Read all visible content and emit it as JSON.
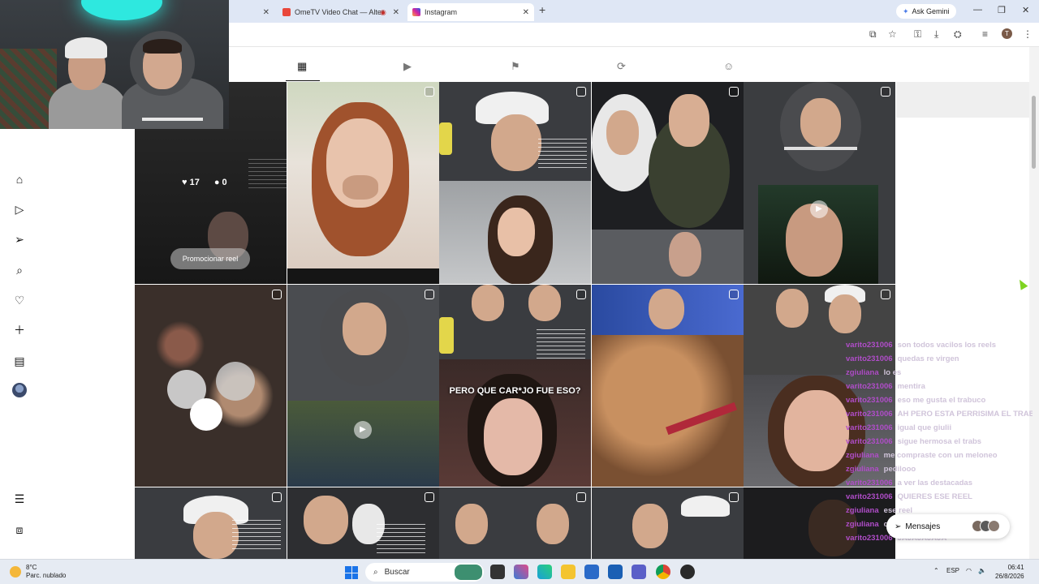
{
  "browser": {
    "tabs": [
      {
        "title": "OmeTV Video Chat — Alter",
        "active": false
      },
      {
        "title": "Instagram",
        "active": true
      }
    ],
    "new_tab": "+",
    "ask_gemini": "Ask Gemini",
    "profile_initial": "T"
  },
  "instagram": {
    "profile_tabs": [
      "posts",
      "reels",
      "saved",
      "reposts",
      "tagged"
    ],
    "first_post": {
      "likes": "17",
      "comments": "0",
      "promote_label": "Promocionar reel"
    },
    "caption_overlay": "PERO QUE CAR*JO FUE ESO?"
  },
  "stream_chat": [
    {
      "user": "varito231006",
      "message": "son todos vacilos los reels"
    },
    {
      "user": "varito231006",
      "message": "quedas re virgen"
    },
    {
      "user": "zgiuliana",
      "message": "lo es"
    },
    {
      "user": "varito231006",
      "message": "mentira"
    },
    {
      "user": "varito231006",
      "message": "eso me gusta el trabuco"
    },
    {
      "user": "varito231006",
      "message": "AH PERO ESTA PERRISIMA EL TRABA"
    },
    {
      "user": "varito231006",
      "message": "igual que giulii"
    },
    {
      "user": "varito231006",
      "message": "sigue hermosa el trabs"
    },
    {
      "user": "zgiuliana",
      "message": "me compraste con un meloneo"
    },
    {
      "user": "zgiuliana",
      "message": "pedilooo"
    },
    {
      "user": "varito231006",
      "message": "a ver las destacadas"
    },
    {
      "user": "varito231006",
      "message": "QUIERES ESE REEL"
    },
    {
      "user": "zgiuliana",
      "message": "ese reel"
    },
    {
      "user": "zgiuliana",
      "message": "corte re paleros"
    },
    {
      "user": "varito231006",
      "message": "JAJAJAJAJA"
    }
  ],
  "messages_pill": "Mensajes",
  "taskbar": {
    "weather_temp": "8°C",
    "weather_desc": "Parc. nublado",
    "search_placeholder": "Buscar",
    "lang": "ESP",
    "time": "06:41",
    "date": "26/8/2026"
  },
  "colors": {
    "chat_username": "#b04dc9",
    "accent_blue": "#1a73e8",
    "cursor": "#7fd321"
  }
}
